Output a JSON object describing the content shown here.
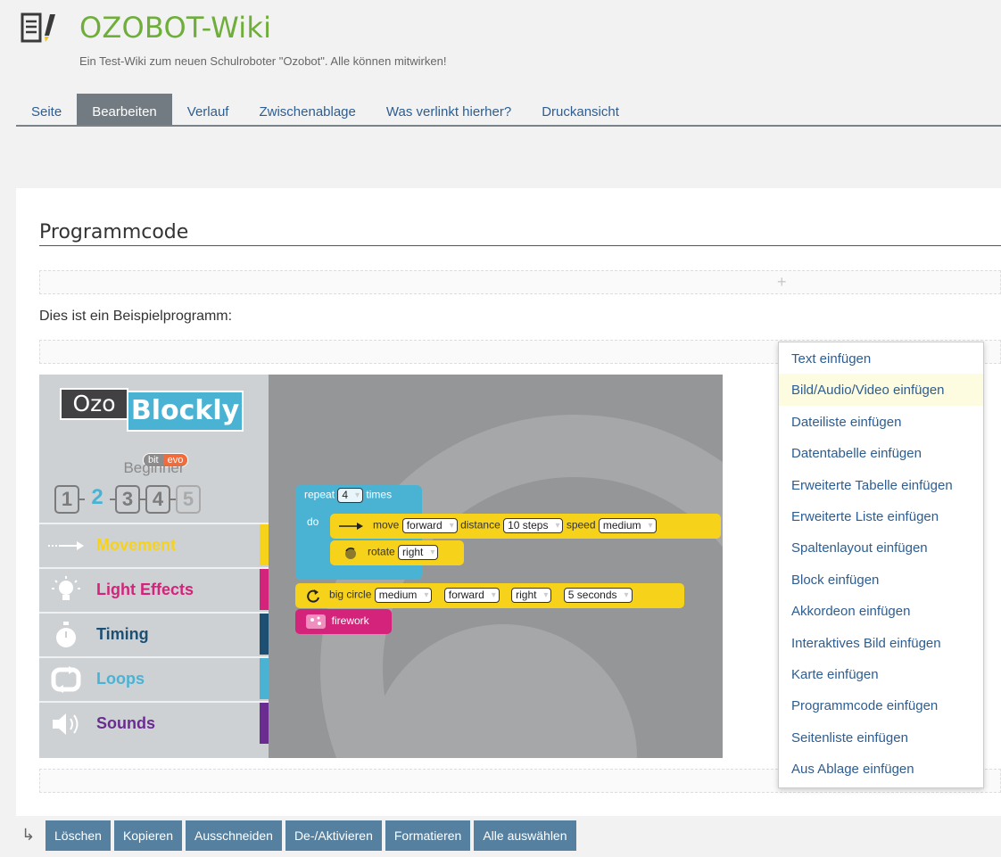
{
  "site": {
    "title": "OZOBOT-Wiki",
    "subtitle": "Ein Test-Wiki zum neuen Schulroboter \"Ozobot\". Alle können mitwirken!"
  },
  "tabs": [
    {
      "label": "Seite",
      "active": false
    },
    {
      "label": "Bearbeiten",
      "active": true
    },
    {
      "label": "Verlauf",
      "active": false
    },
    {
      "label": "Zwischenablage",
      "active": false
    },
    {
      "label": "Was verlinkt hierher?",
      "active": false
    },
    {
      "label": "Druckansicht",
      "active": false
    }
  ],
  "content": {
    "heading": "Programmcode",
    "paragraph": "Dies ist ein Beispielprogramm:"
  },
  "ozoblockly": {
    "logo_ozo": "Ozo",
    "logo_blockly": "Blockly",
    "logo_bit": "bit",
    "logo_evo": "evo",
    "level_name": "Beginner",
    "levels": [
      "1",
      "2",
      "3",
      "4",
      "5"
    ],
    "current_level": "2",
    "categories": [
      {
        "label": "Movement",
        "color": "#f7d21b",
        "icon": "arrow-icon"
      },
      {
        "label": "Light Effects",
        "color": "#d4237a",
        "icon": "bulb-icon"
      },
      {
        "label": "Timing",
        "color": "#1d4f73",
        "icon": "stopwatch-icon"
      },
      {
        "label": "Loops",
        "color": "#4ab3d4",
        "icon": "loop-icon"
      },
      {
        "label": "Sounds",
        "color": "#6b2c91",
        "icon": "speaker-icon"
      }
    ],
    "blocks": {
      "repeat_label": "repeat",
      "repeat_count": "4",
      "times_label": "times",
      "do_label": "do",
      "move_label": "move",
      "move_dir": "forward",
      "distance_label": "distance",
      "distance_val": "10 steps",
      "speed_label": "speed",
      "speed_val": "medium",
      "rotate_label": "rotate",
      "rotate_val": "right",
      "circle_label": "big circle",
      "circle_speed": "medium",
      "circle_dir": "forward",
      "circle_turn": "right",
      "circle_time": "5 seconds",
      "firework_label": "firework"
    }
  },
  "insert_menu": {
    "items": [
      "Text einfügen",
      "Bild/Audio/Video einfügen",
      "Dateiliste einfügen",
      "Datentabelle einfügen",
      "Erweiterte Tabelle einfügen",
      "Erweiterte Liste einfügen",
      "Spaltenlayout einfügen",
      "Block einfügen",
      "Akkordeon einfügen",
      "Interaktives Bild einfügen",
      "Karte einfügen",
      "Programmcode einfügen",
      "Seitenliste einfügen",
      "Aus Ablage einfügen"
    ],
    "highlighted": 1
  },
  "toolbar": {
    "buttons": [
      "Löschen",
      "Kopieren",
      "Ausschneiden",
      "De-/Aktivieren",
      "Formatieren",
      "Alle auswählen"
    ]
  }
}
